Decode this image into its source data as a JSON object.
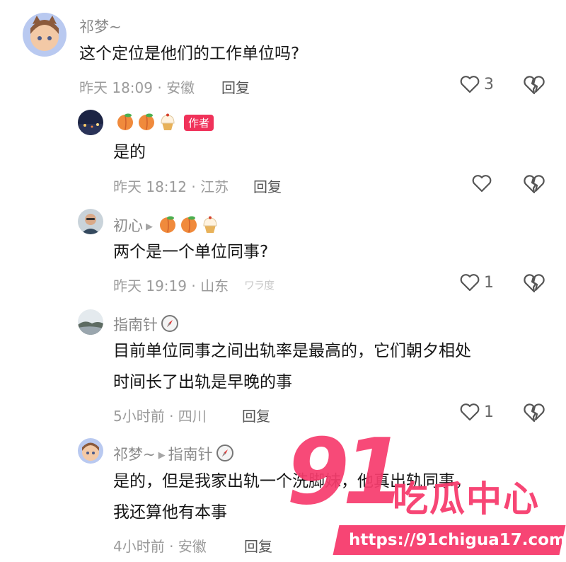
{
  "comments": [
    {
      "name": "祁梦~",
      "text": "这个定位是他们的工作单位吗?",
      "time": "昨天 18:09 · 安徽",
      "reply": "回复",
      "likes": "3"
    },
    {
      "badge": "作者",
      "text": "是的",
      "time": "昨天 18:12 · 江苏",
      "reply": "回复",
      "likes": ""
    },
    {
      "name": "初心",
      "text": "两个是一个单位同事?",
      "time": "昨天 19:19 · 山东",
      "reply": "回复",
      "likes": "1",
      "smudge": "ワラ度"
    },
    {
      "name": "指南针",
      "text_lines": [
        "目前单位同事之间出轨率是最高的，它们朝夕相处",
        "时间长了出轨是早晚的事"
      ],
      "time": "5小时前 · 四川",
      "reply": "回复",
      "likes": "1"
    },
    {
      "name": "祁梦~",
      "reply_to": "指南针",
      "text_lines": [
        "是的，但是我家出轨一个洗脚妹，他真出轨同事，",
        "我还算他有本事"
      ],
      "time": "4小时前 · 安徽",
      "reply": "回复",
      "likes": ""
    }
  ],
  "watermark": {
    "number": "91",
    "brand": "吃瓜中心",
    "url": "https://91chigua17.com"
  },
  "colors": {
    "badge": "#f0325a",
    "watermark": "#f73d6e",
    "meta": "#9b9b9b"
  }
}
